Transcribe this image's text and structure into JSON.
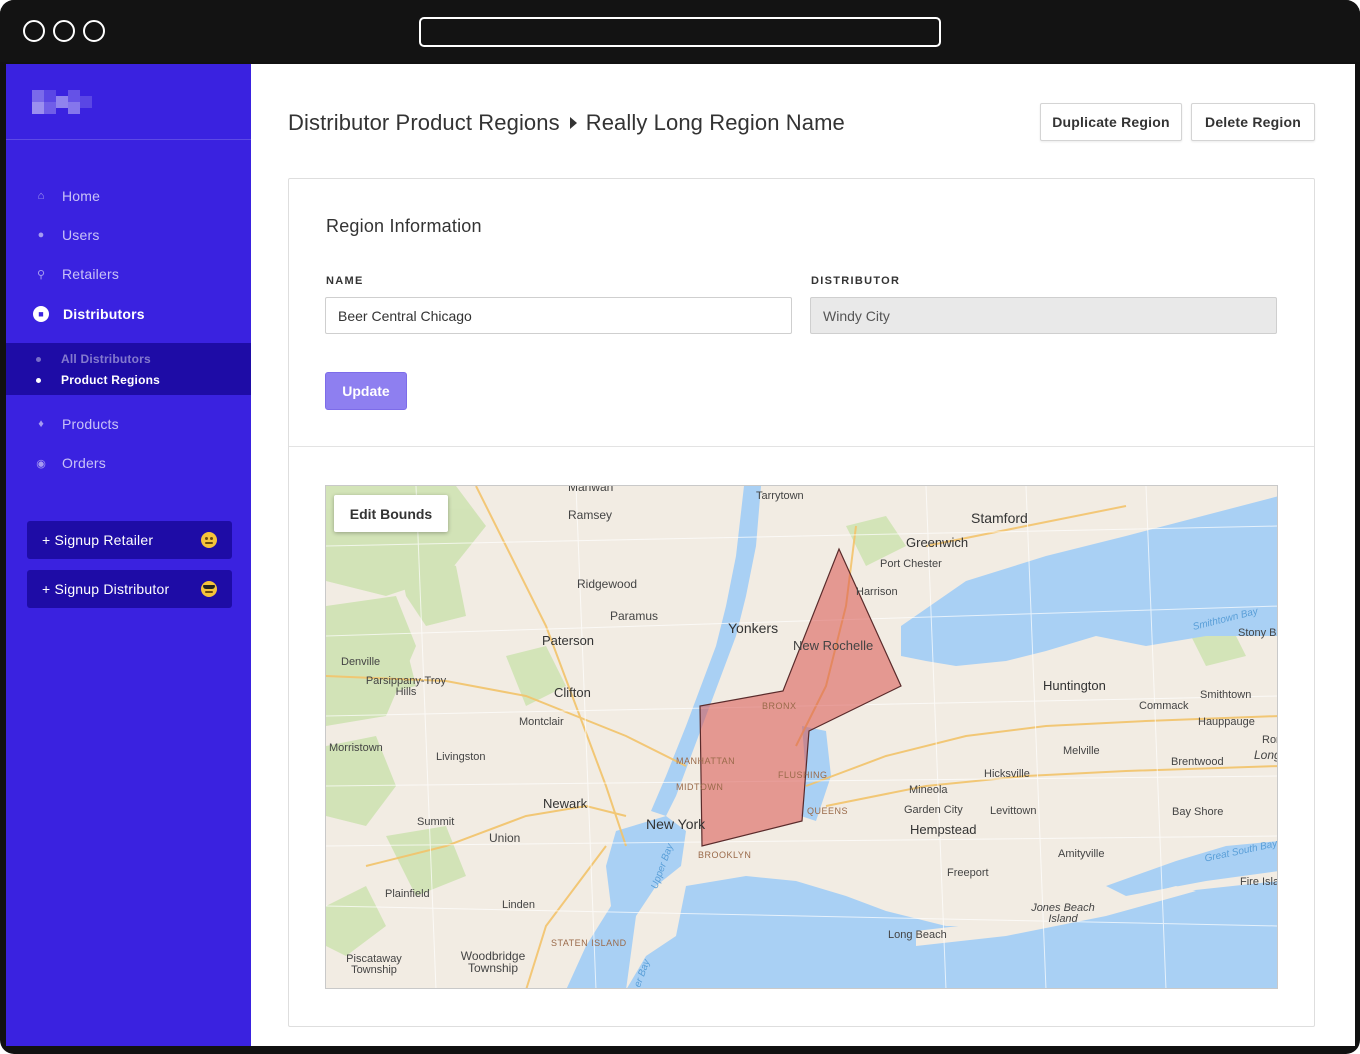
{
  "header": {
    "title": "Distributor Product Regions",
    "subtitle": "Really Long Region Name",
    "duplicate_label": "Duplicate Region",
    "delete_label": "Delete Region"
  },
  "sidebar": {
    "items": [
      {
        "label": "Home",
        "icon": "home-icon"
      },
      {
        "label": "Users",
        "icon": "users-icon"
      },
      {
        "label": "Retailers",
        "icon": "map-pin-icon"
      },
      {
        "label": "Distributors",
        "icon": "truck-icon"
      },
      {
        "label": "Products",
        "icon": "tag-icon"
      },
      {
        "label": "Orders",
        "icon": "dollar-icon"
      }
    ],
    "subitems": [
      {
        "label": "All Distributors"
      },
      {
        "label": "Product Regions"
      }
    ],
    "signup_retailer": "+ Signup Retailer",
    "signup_distributor": "+ Signup Distributor",
    "colors": {
      "sidebar": "#3a22e0",
      "active_bg": "#1e0ca6"
    }
  },
  "form": {
    "section_title": "Region Information",
    "name_label": "NAME",
    "name_value": "Beer Central Chicago",
    "distributor_label": "DISTRIBUTOR",
    "distributor_value": "Windy City",
    "update_label": "Update",
    "accent": "#8e7ff0"
  },
  "map": {
    "edit_bounds_label": "Edit Bounds",
    "region_color": "#d9534f",
    "labels": [
      "Mahwah",
      "Tarrytown",
      "Stamford",
      "Ramsey",
      "Greenwich",
      "Port Chester",
      "Ridgewood",
      "Harrison",
      "Paramus",
      "Yonkers",
      "Smithtown Bay",
      "Stony B",
      "Paterson",
      "New Rochelle",
      "Denville",
      "Parsippany-Troy Hills",
      "Clifton",
      "Huntington",
      "Smithtown",
      "Commack",
      "Hauppauge",
      "Montclair",
      "BRONX",
      "Morristown",
      "Melville",
      "Ronko",
      "Livingston",
      "MANHATTAN",
      "FLUSHING",
      "Hicksville",
      "Brentwood",
      "Long Is",
      "MIDTOWN",
      "Newark",
      "Mineola",
      "Garden City",
      "Levittown",
      "Bay Shore",
      "QUEENS",
      "Summit",
      "New York",
      "Hempstead",
      "Union",
      "BROOKLYN",
      "Amityville",
      "Great South Bay",
      "Plainfield",
      "Freeport",
      "Fire Isla",
      "Linden",
      "Jones Beach Island",
      "Long Beach",
      "STATEN ISLAND",
      "Piscataway Township",
      "Woodbridge Township",
      "Upper Bay",
      "er Bay"
    ]
  }
}
